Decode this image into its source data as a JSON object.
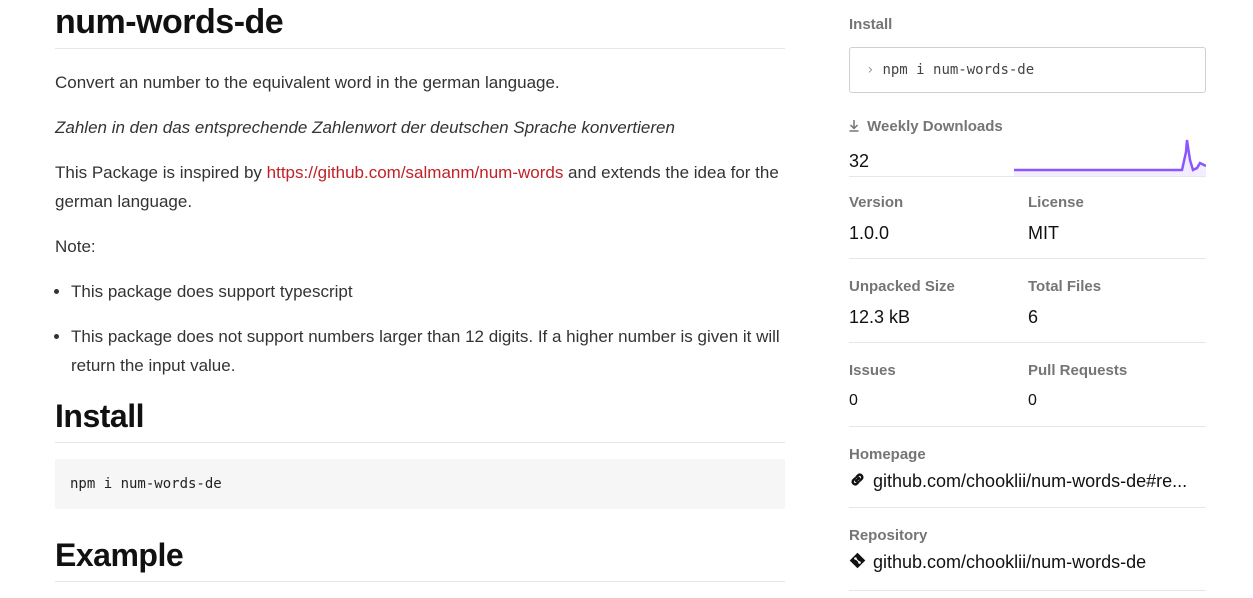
{
  "readme": {
    "title": "num-words-de",
    "intro": "Convert an number to the equivalent word in the german language.",
    "intro_de": "Zahlen in den das entsprechende Zahlenwort der deutschen Sprache konvertieren",
    "inspired_prefix": "This Package is inspired by ",
    "inspired_link": "https://github.com/salmanm/num-words",
    "inspired_suffix": " and extends the idea for the german language.",
    "note": "Note:",
    "notes": [
      "This package does support typescript",
      "This package does not support numbers larger than 12 digits. If a higher number is given it will return the input value."
    ],
    "install_heading": "Install",
    "install_code": "npm i num-words-de",
    "example_heading": "Example"
  },
  "sidebar": {
    "install_label": "Install",
    "install_prompt": "›",
    "install_command": "npm i num-words-de",
    "weekly_downloads_label": "Weekly Downloads",
    "weekly_downloads_icon": "download-icon",
    "weekly_downloads": "32",
    "version_label": "Version",
    "version": "1.0.0",
    "license_label": "License",
    "license": "MIT",
    "unpacked_size_label": "Unpacked Size",
    "unpacked_size": "12.3 kB",
    "total_files_label": "Total Files",
    "total_files": "6",
    "issues_label": "Issues",
    "issues": "0",
    "pull_requests_label": "Pull Requests",
    "pull_requests": "0",
    "homepage_label": "Homepage",
    "homepage": "github.com/chooklii/num-words-de#re...",
    "homepage_icon": "link-icon",
    "repository_label": "Repository",
    "repository": "github.com/chooklii/num-words-de",
    "repository_icon": "git-icon"
  },
  "colors": {
    "link": "#c12127",
    "sparkline": "#8956ff",
    "sparkline_fill": "#f3eeff"
  }
}
